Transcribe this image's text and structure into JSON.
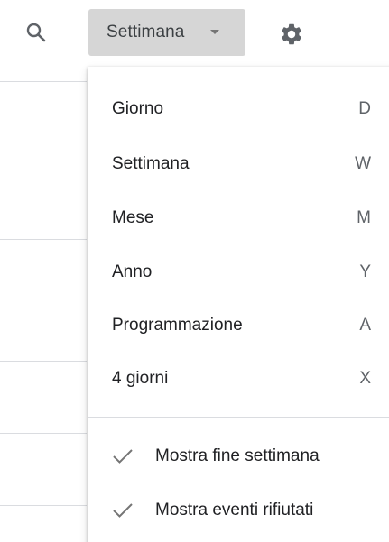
{
  "toolbar": {
    "search_icon": "search-icon",
    "view_select_label": "Settimana",
    "settings_icon": "gear-icon"
  },
  "menu": {
    "items": [
      {
        "label": "Giorno",
        "shortcut": "D"
      },
      {
        "label": "Settimana",
        "shortcut": "W"
      },
      {
        "label": "Mese",
        "shortcut": "M"
      },
      {
        "label": "Anno",
        "shortcut": "Y"
      },
      {
        "label": "Programmazione",
        "shortcut": "A"
      },
      {
        "label": "4 giorni",
        "shortcut": "X"
      }
    ],
    "options": [
      {
        "label": "Mostra fine settimana",
        "checked": true,
        "icon": "check-icon"
      },
      {
        "label": "Mostra eventi rifiutati",
        "checked": true,
        "icon": "check-icon"
      }
    ]
  },
  "colors": {
    "select_background": "#d6d6d6",
    "icon_grey": "#5f6368",
    "divider": "#dadce0"
  }
}
